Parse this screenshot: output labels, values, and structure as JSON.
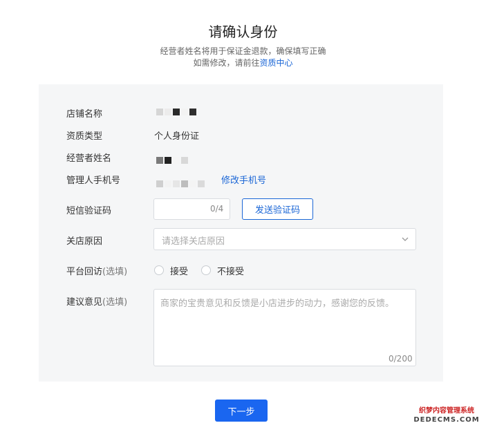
{
  "header": {
    "title": "请确认身份",
    "desc_line1": "经营者姓名将用于保证金退款，确保填写正确",
    "desc_line2_prefix": "如需修改，请前往",
    "desc_link": "资质中心"
  },
  "form": {
    "shop_name": {
      "label": "店铺名称"
    },
    "qualification": {
      "label": "资质类型",
      "value": "个人身份证"
    },
    "operator": {
      "label": "经营者姓名"
    },
    "phone": {
      "label": "管理人手机号",
      "action": "修改手机号"
    },
    "sms": {
      "label": "短信验证码",
      "counter": "0/4",
      "button": "发送验证码"
    },
    "reason": {
      "label": "关店原因",
      "placeholder": "请选择关店原因"
    },
    "visit": {
      "label": "平台回访",
      "hint": "(选填)",
      "options": [
        "接受",
        "不接受"
      ]
    },
    "suggestion": {
      "label": "建议意见",
      "hint": "(选填)",
      "placeholder": "商家的宝贵意见和反馈是小店进步的动力，感谢您的反馈。",
      "counter": "0/200"
    }
  },
  "footer": {
    "next_button": "下一步"
  },
  "watermark": {
    "line1": "织梦内容管理系统",
    "line2": "DEDECMS.COM"
  },
  "colors": {
    "accent": "#1a66d6",
    "primary": "#1a66f0",
    "panel_bg": "#f5f6f7"
  }
}
